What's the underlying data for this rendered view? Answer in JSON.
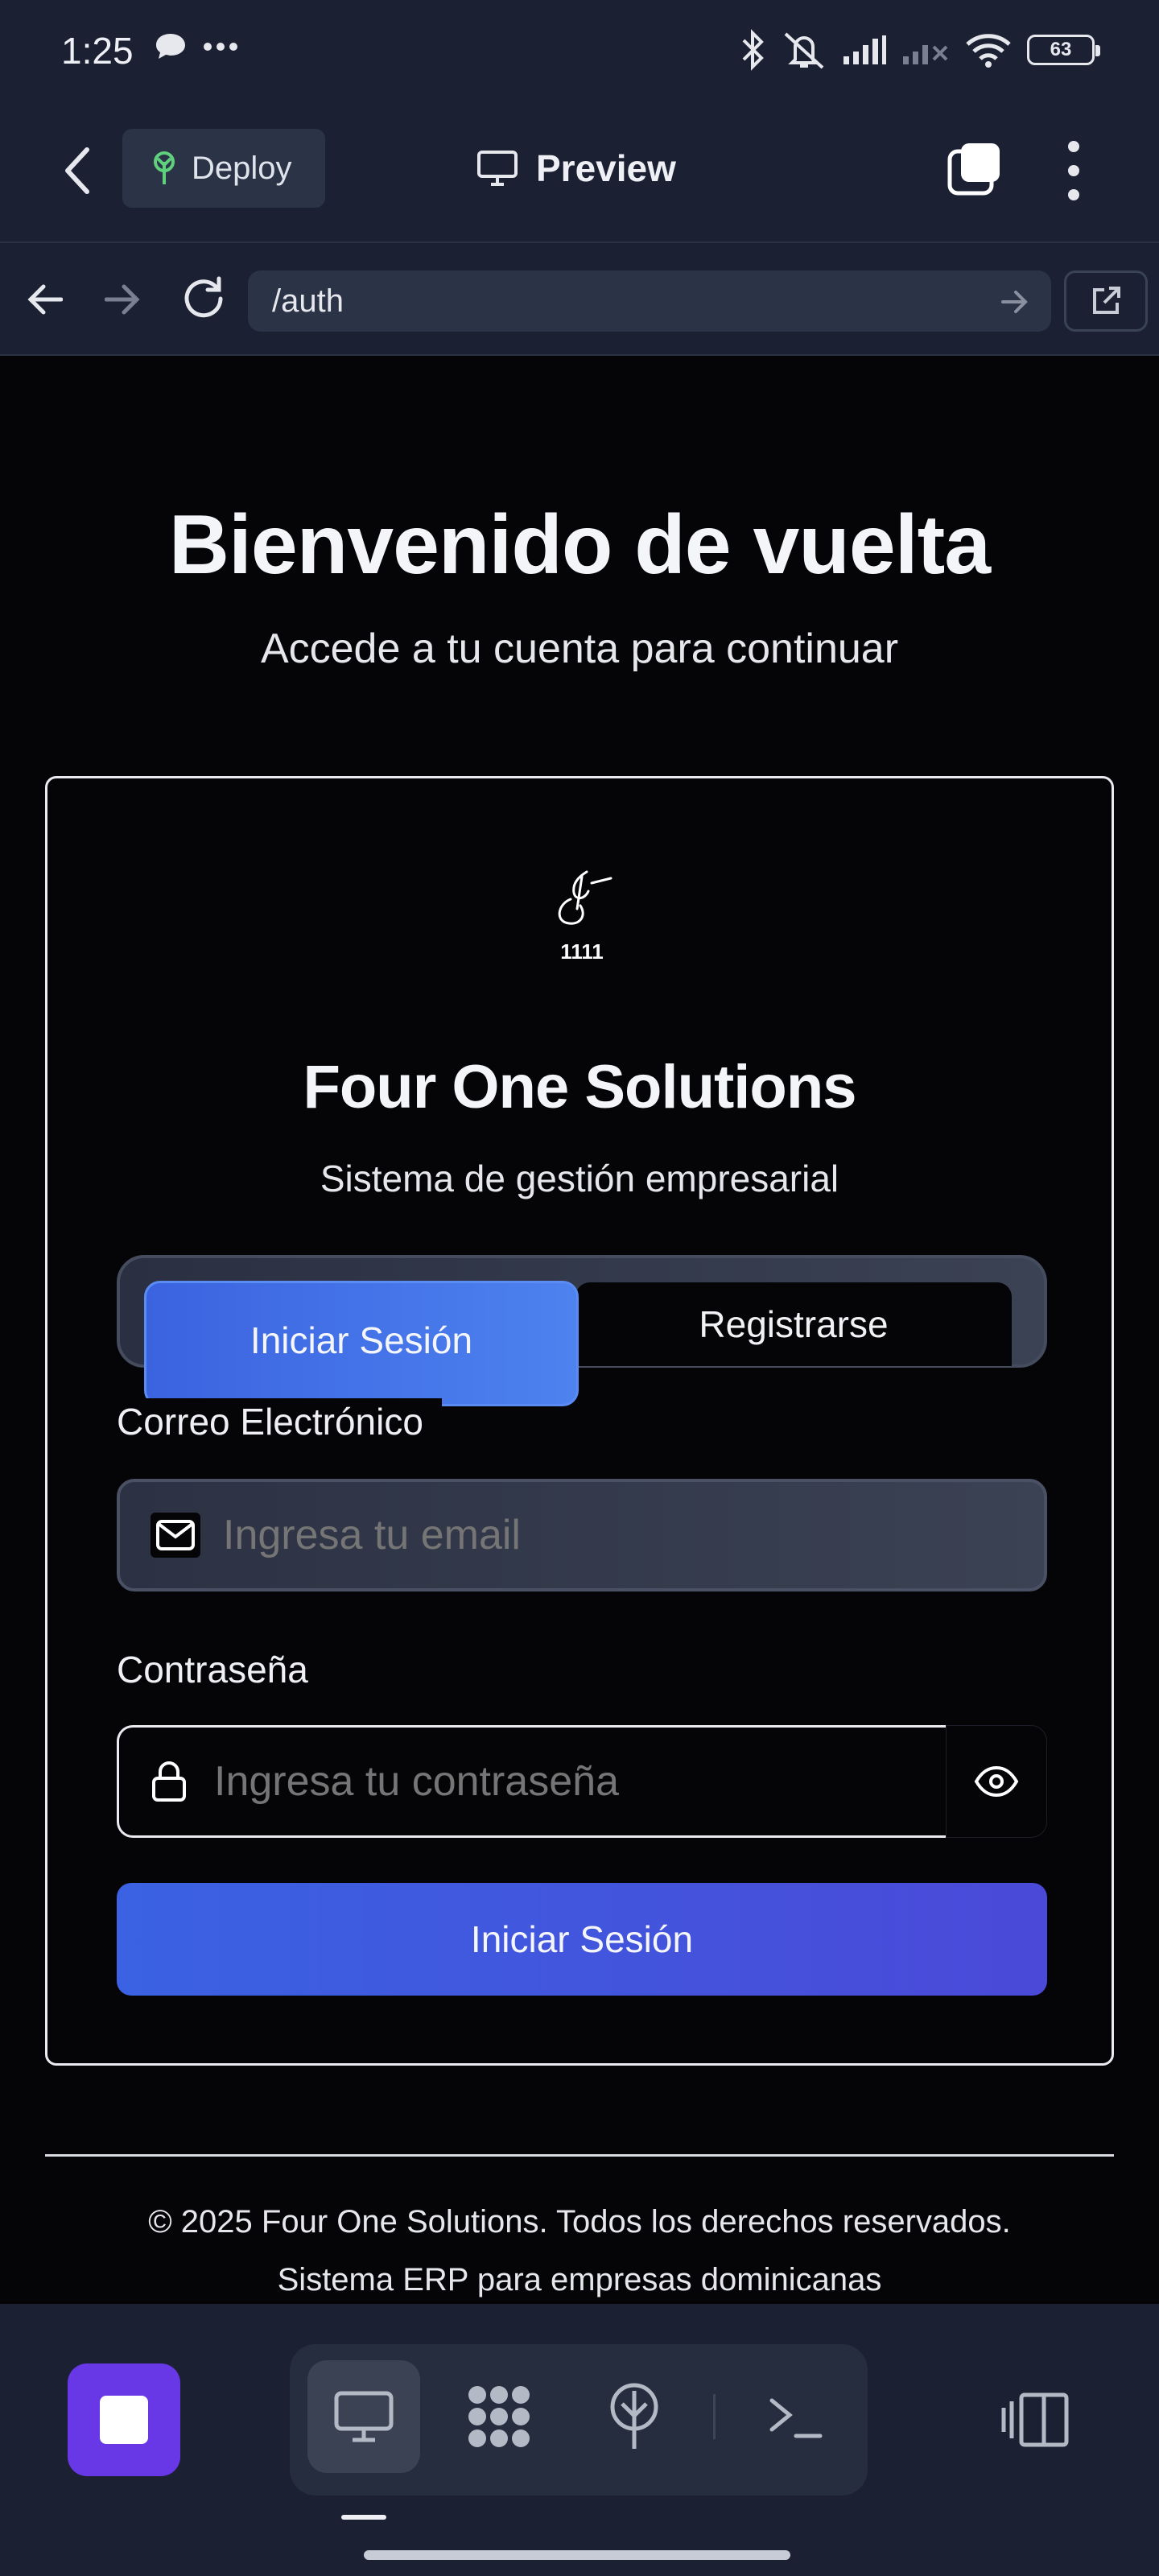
{
  "status_bar": {
    "time": "1:25",
    "battery": "63",
    "icons": [
      "chat-bubble-icon",
      "more-dots-icon",
      "bluetooth-icon",
      "vibrate-off-icon",
      "signal-icon",
      "signal-weak-icon",
      "wifi-icon",
      "battery-icon"
    ]
  },
  "header": {
    "back_icon": "chevron-left-icon",
    "deploy_label": "Deploy",
    "preview_label": "Preview",
    "tabs_icon": "tabs-icon",
    "menu_icon": "kebab-menu-icon"
  },
  "browser": {
    "url": "/auth",
    "icons": [
      "arrow-left-icon",
      "arrow-right-icon",
      "reload-icon",
      "go-arrow-icon",
      "open-external-icon"
    ]
  },
  "page": {
    "title": "Bienvenido de vuelta",
    "subtitle": "Accede a tu cuenta para continuar"
  },
  "card": {
    "logo_number": "1111",
    "company_name": "Four One Solutions",
    "tagline": "Sistema de gestión empresarial",
    "tabs": {
      "login": "Iniciar Sesión",
      "register": "Registrarse",
      "active": "login"
    },
    "email": {
      "label": "Correo Electrónico",
      "placeholder": "Ingresa tu email",
      "value": ""
    },
    "password": {
      "label": "Contraseña",
      "placeholder": "Ingresa tu contraseña",
      "value": ""
    },
    "submit_label": "Iniciar Sesión"
  },
  "footer": {
    "copyright": "© 2025 Four One Solutions. Todos los derechos reservados.",
    "subtitle": "Sistema ERP para empresas dominicanas"
  },
  "dock": {
    "icons": [
      "stop-icon",
      "desktop-icon",
      "workflow-icon",
      "deploy-tree-icon",
      "terminal-icon",
      "panel-toggle-icon"
    ]
  },
  "colors": {
    "accent_blue": "#3b63e0",
    "stop_purple": "#6938e6",
    "chrome_bg": "#1b2132",
    "page_bg": "#050507"
  }
}
